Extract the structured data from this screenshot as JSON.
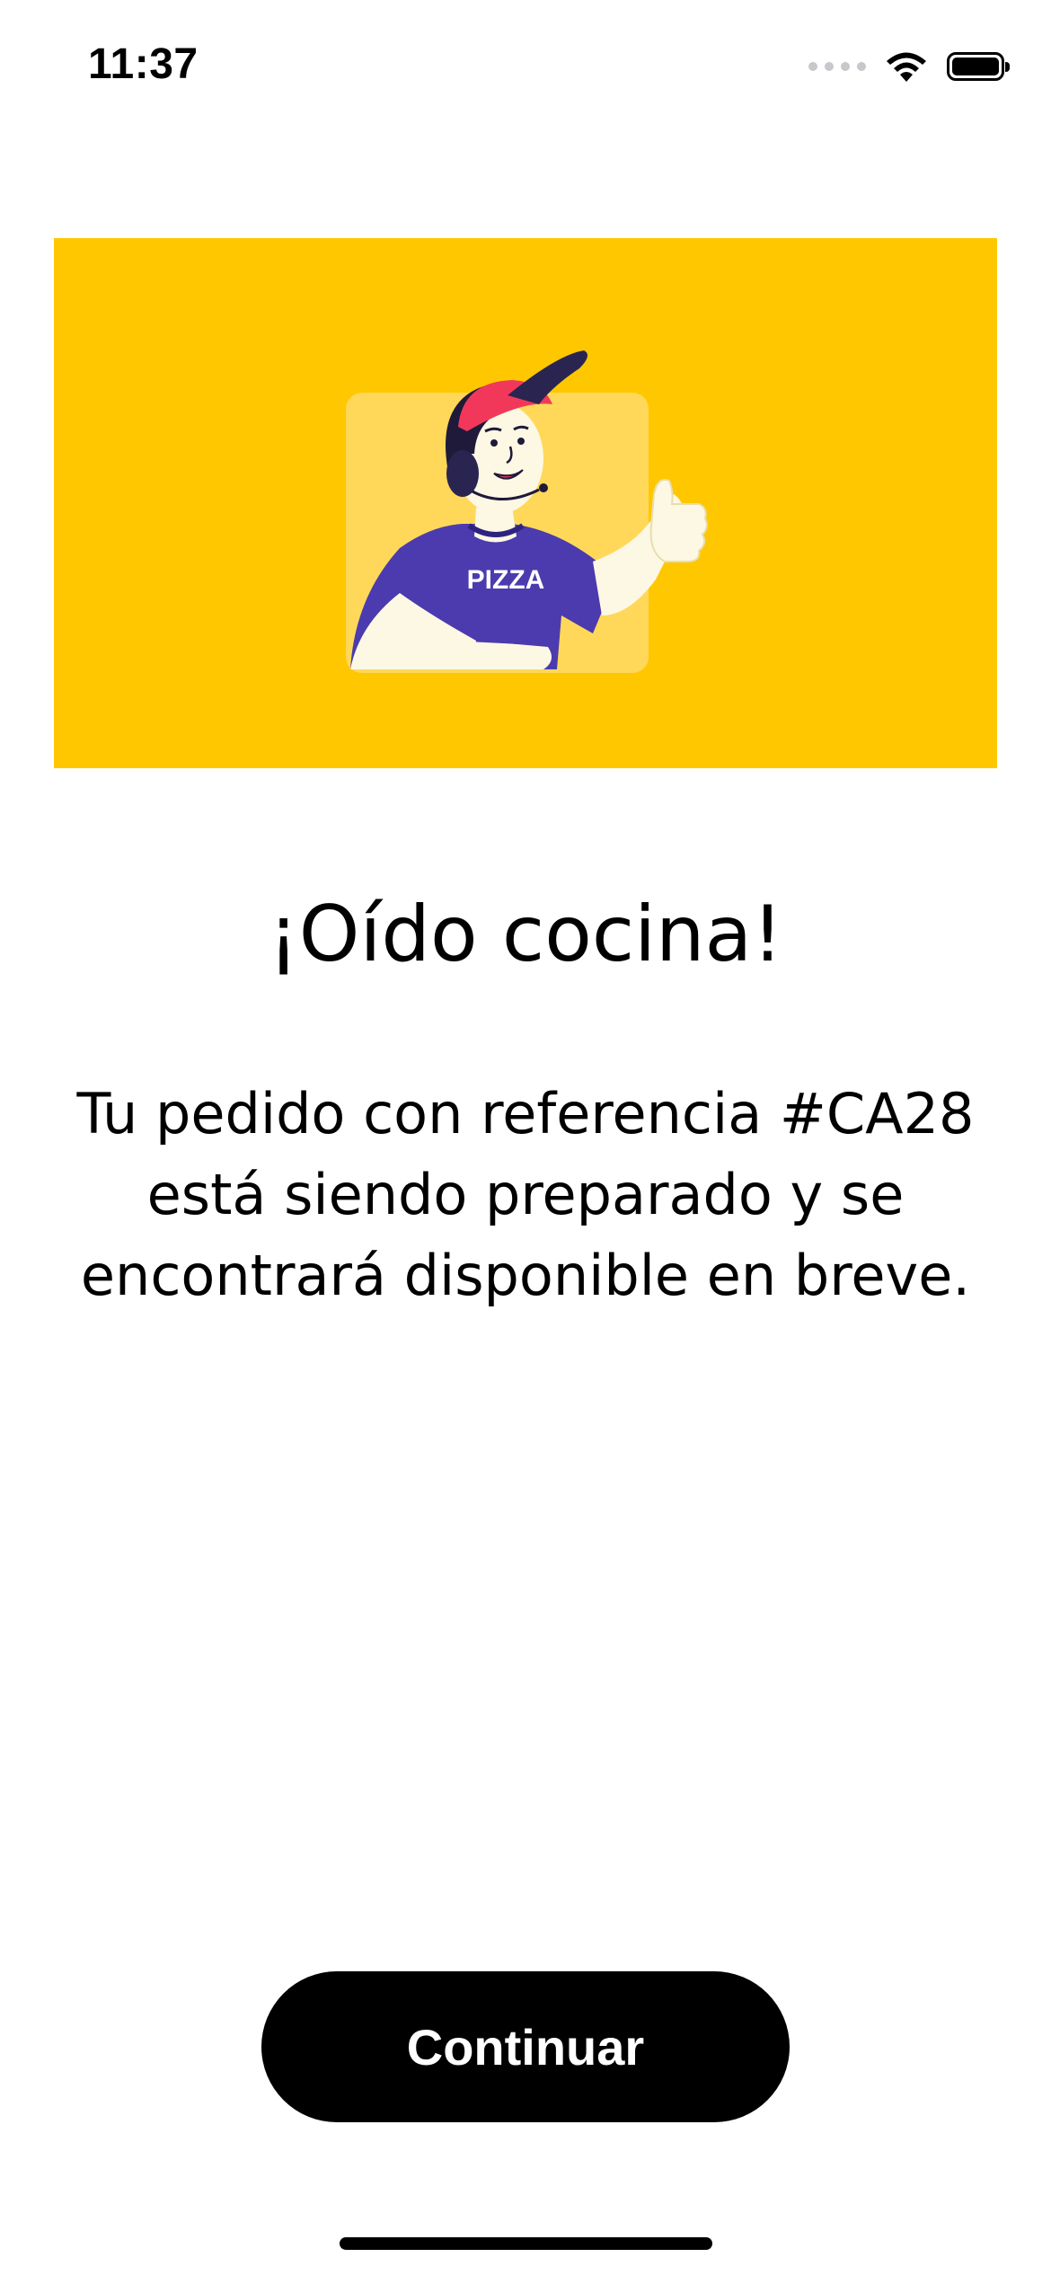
{
  "status_bar": {
    "time": "11:37"
  },
  "hero": {
    "background_color": "#FFC700",
    "shirt_text": "PIZZA",
    "illustration": "pizza-operator-thumbs-up"
  },
  "title": "¡Oído cocina!",
  "message": "Tu pedido con referencia #CA28 está siendo preparado y se encontrará disponible en breve.",
  "continue_button": {
    "label": "Continuar"
  }
}
